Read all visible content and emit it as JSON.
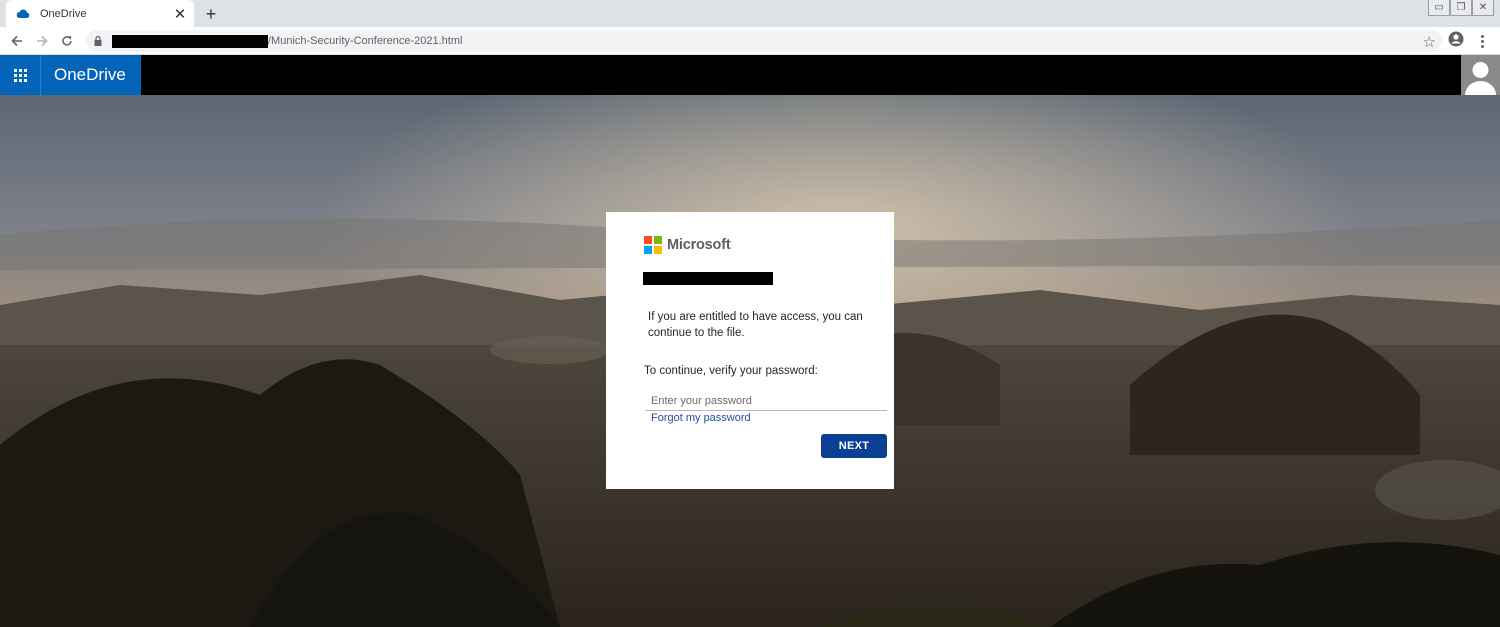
{
  "browser": {
    "tab_title": "OneDrive",
    "tab_close": "✕",
    "new_tab": "+",
    "url_path": "/Munich-Security-Conference-2021.html",
    "window_controls": [
      "▭",
      "❐",
      "✕"
    ],
    "icons": [
      "onedrive-cloud-icon",
      "back-arrow-icon",
      "forward-arrow-icon",
      "reload-icon",
      "lock-icon",
      "star-icon",
      "profile-icon",
      "kebab-menu-icon"
    ]
  },
  "header": {
    "app_name": "OneDrive",
    "brand_color": "#0364b8",
    "icons": [
      "app-launcher-waffle-icon",
      "user-avatar-icon"
    ]
  },
  "dialog": {
    "brand": "Microsoft",
    "logo_colors": [
      "#f25022",
      "#7fba00",
      "#00a4ef",
      "#ffb900"
    ],
    "message": "If you are entitled to have access, you can continue to the file.",
    "prompt": "To continue, verify your password:",
    "password_placeholder": "Enter your password",
    "password_value": "",
    "forgot_link": "Forgot my password",
    "next_label": "NEXT",
    "next_color": "#0b3f94"
  }
}
